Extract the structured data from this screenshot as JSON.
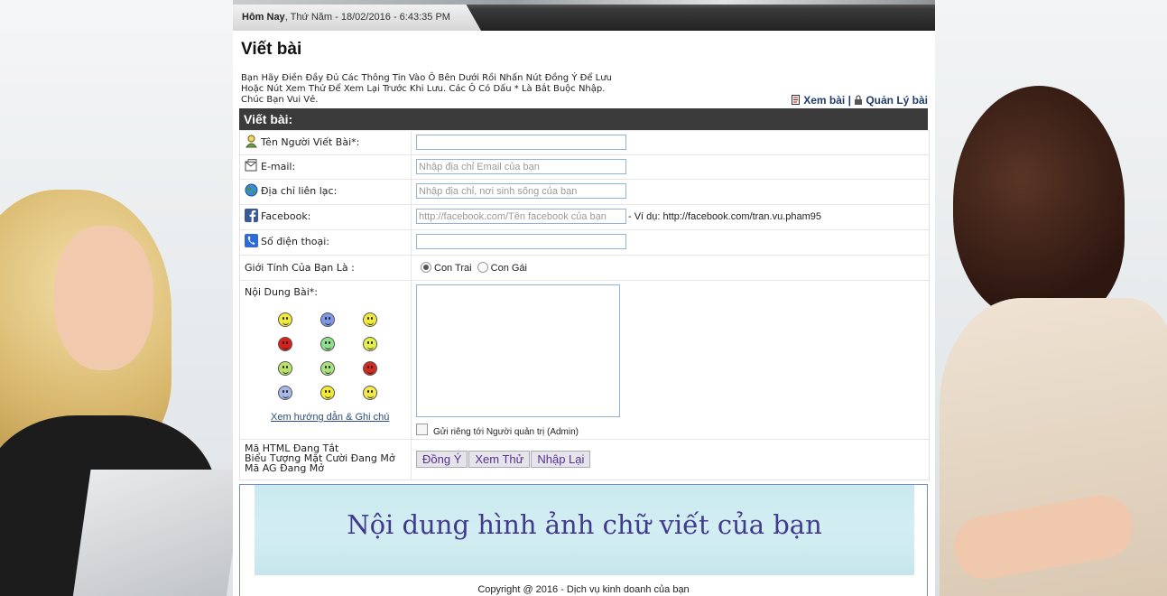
{
  "header": {
    "today_label": "Hôm Nay",
    "date_text": ", Thứ Năm - 18/02/2016 - 6:43:35 PM"
  },
  "page_title": "Viết bài",
  "intro": [
    "Bạn Hãy Điền Đầy Đủ Các Thông Tin Vào Ô Bên Dưới Rồi Nhấn Nút Đồng Ý Để Lưu",
    "Hoặc Nút Xem Thử Để Xem Lại Trước Khi Lưu. Các Ô Có Dấu * Là Bắt Buộc Nhập.",
    "Chúc Bạn Vui Vẻ."
  ],
  "links": {
    "view": "Xem bài",
    "separator": "|",
    "manage": "Quản Lý bài"
  },
  "section_title": "Viết bài:",
  "fields": {
    "author": {
      "label": "Tên Người Viết Bài*:",
      "value": "",
      "placeholder": ""
    },
    "email": {
      "label": "E-mail:",
      "value": "",
      "placeholder": "Nhập địa chỉ Email của bạn"
    },
    "address": {
      "label": "Địa chỉ liên lạc:",
      "value": "",
      "placeholder": "Nhập địa chỉ, nơi sinh sống của bạn"
    },
    "facebook": {
      "label": "Facebook:",
      "value": "",
      "placeholder": "http://facebook.com/Tên facebook của bạn",
      "hint": "- Ví dụ: http://facebook.com/tran.vu.pham95"
    },
    "phone": {
      "label": "Số điện thoại:",
      "value": "",
      "placeholder": ""
    },
    "gender": {
      "label": "Giới Tính Của Bạn Là :",
      "options": [
        "Con Trai",
        "Con Gái"
      ],
      "selected": "Con Trai"
    },
    "content": {
      "label": "Nội Dung Bài*:",
      "value": ""
    }
  },
  "smileys": [
    {
      "icon": "smile-icon",
      "color": "#f2ea3a"
    },
    {
      "icon": "sad-icon",
      "color": "#7f97e8"
    },
    {
      "icon": "grin-icon",
      "color": "#f2ea3a"
    },
    {
      "icon": "angry-icon",
      "color": "#d6201c"
    },
    {
      "icon": "teeth-icon",
      "color": "#8fe08a"
    },
    {
      "icon": "wink-icon",
      "color": "#e4f04a"
    },
    {
      "icon": "cool-icon",
      "color": "#b9e36c"
    },
    {
      "icon": "sick-icon",
      "color": "#a9e27e"
    },
    {
      "icon": "mad-icon",
      "color": "#d32a22"
    },
    {
      "icon": "shocked-icon",
      "color": "#a7b8e8"
    },
    {
      "icon": "happy-icon",
      "color": "#f3ea36"
    },
    {
      "icon": "confused-icon",
      "color": "#f3e94a"
    }
  ],
  "help_link": "Xem hướng dẫn & Ghi chú",
  "private_checkbox": {
    "label": "Gửi riêng tới Người quản trị (Admin)",
    "checked": false
  },
  "status_lines": [
    "Mã HTML Đang Tắt",
    "Biểu Tượng Mặt Cười Đang Mở",
    "Mã AG Đang Mở"
  ],
  "buttons": {
    "submit": "Đồng Ý",
    "preview": "Xem Thử",
    "reset": "Nhập Lại"
  },
  "banner_text": "Nội dung hình ảnh chữ viết của bạn",
  "copyright": "Copyright @ 2016 - Dịch vụ kinh doanh của bạn"
}
